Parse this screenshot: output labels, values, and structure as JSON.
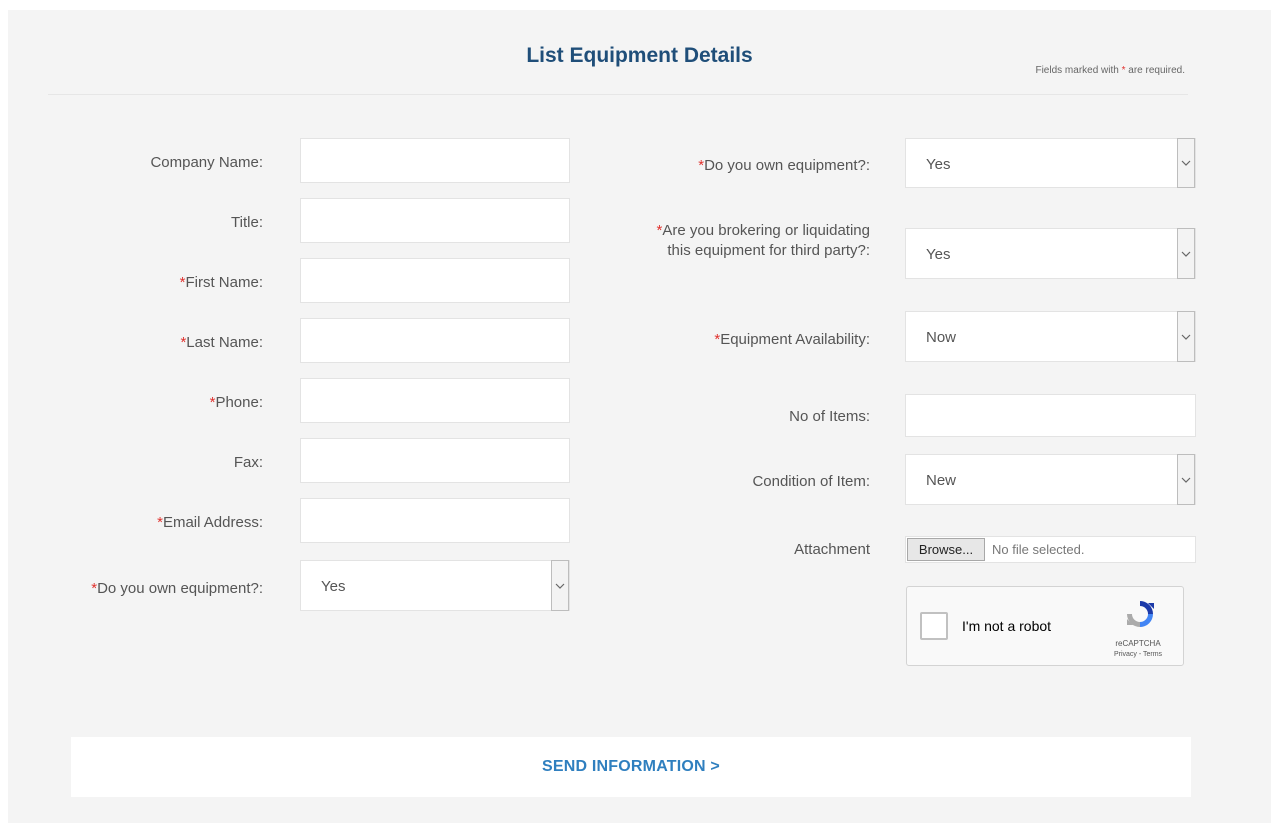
{
  "header": {
    "title": "List Equipment Details",
    "required_note_prefix": "Fields marked with ",
    "required_star": "*",
    "required_note_suffix": " are required."
  },
  "left_fields": [
    {
      "star": "",
      "label": "Company Name:",
      "value": ""
    },
    {
      "star": "",
      "label": "Title:",
      "value": ""
    },
    {
      "star": "*",
      "label": "First Name:",
      "value": ""
    },
    {
      "star": "*",
      "label": "Last Name:",
      "value": ""
    },
    {
      "star": "*",
      "label": "Phone:",
      "value": ""
    },
    {
      "star": "",
      "label": "Fax:",
      "value": ""
    },
    {
      "star": "*",
      "label": "Email Address:",
      "value": ""
    }
  ],
  "left_select": {
    "star": "*",
    "label": "Do you own equipment?:",
    "value": "Yes"
  },
  "right_fields": {
    "own_equipment": {
      "star": "*",
      "label": "Do you own equipment?:",
      "value": "Yes"
    },
    "brokering": {
      "star": "*",
      "label_line1": "Are you brokering or liquidating",
      "label_line2": "this equipment for third party?:",
      "value": "Yes"
    },
    "availability": {
      "star": "*",
      "label": "Equipment Availability:",
      "value": "Now"
    },
    "no_items": {
      "label": "No of Items:",
      "value": ""
    },
    "condition": {
      "label": "Condition of Item:",
      "value": "New"
    },
    "attachment": {
      "label": "Attachment",
      "button": "Browse...",
      "status": "No file selected."
    }
  },
  "captcha": {
    "label": "I'm not a robot",
    "brand": "reCAPTCHA",
    "links": "Privacy - Terms"
  },
  "submit": {
    "label": "SEND INFORMATION  >"
  },
  "colors": {
    "accent": "#2f7fbf",
    "title": "#1f4e79",
    "required": "#e0312d",
    "panel": "#f4f4f4"
  },
  "icons": {
    "select_toggle": "chevron-down-icon",
    "captcha_logo": "recaptcha-icon"
  }
}
